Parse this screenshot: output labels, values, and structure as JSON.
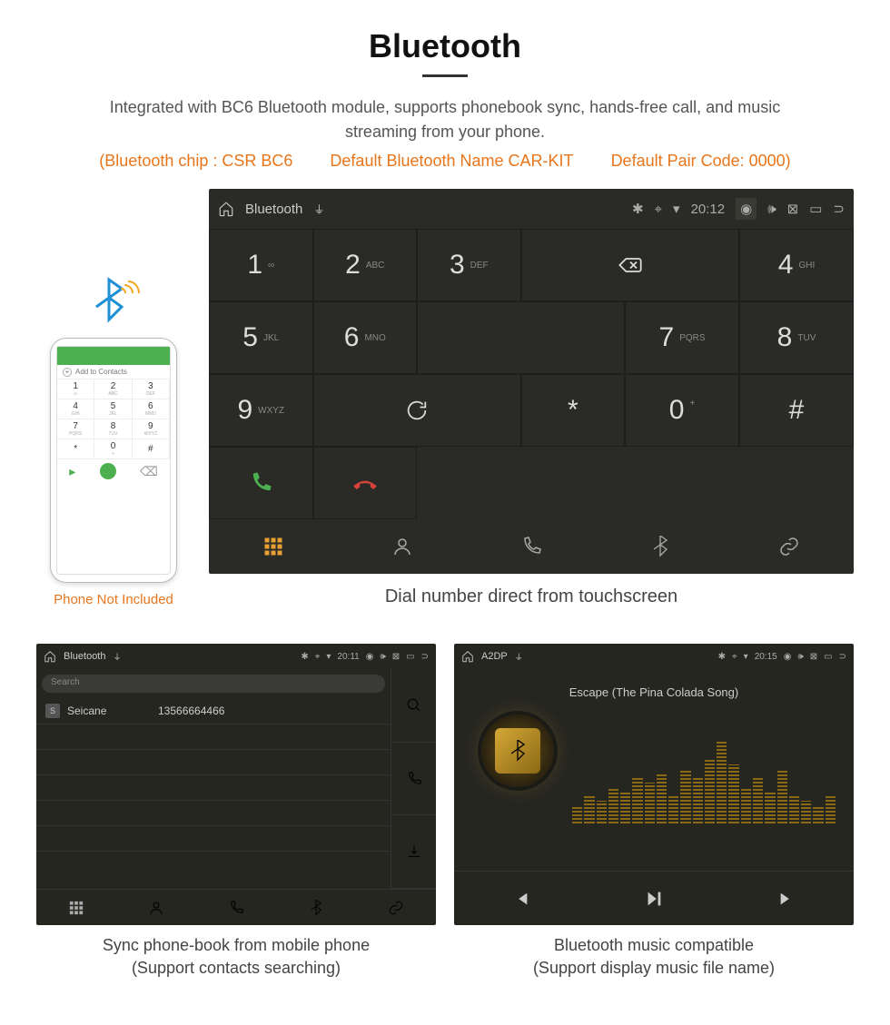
{
  "title": "Bluetooth",
  "description": "Integrated with BC6 Bluetooth module, supports phonebook sync, hands-free call, and music streaming from your phone.",
  "info": {
    "chip": "(Bluetooth chip : CSR BC6",
    "name": "Default Bluetooth Name CAR-KIT",
    "code": "Default Pair Code: 0000)"
  },
  "phone": {
    "add_contacts": "Add to Contacts",
    "caption": "Phone Not Included"
  },
  "dialer": {
    "topbar": {
      "title": "Bluetooth",
      "time": "20:12"
    },
    "keys": [
      {
        "n": "1",
        "s": "∞"
      },
      {
        "n": "2",
        "s": "ABC"
      },
      {
        "n": "3",
        "s": "DEF"
      },
      {
        "n": "4",
        "s": "GHI"
      },
      {
        "n": "5",
        "s": "JKL"
      },
      {
        "n": "6",
        "s": "MNO"
      },
      {
        "n": "7",
        "s": "PQRS"
      },
      {
        "n": "8",
        "s": "TUV"
      },
      {
        "n": "9",
        "s": "WXYZ"
      },
      {
        "n": "*",
        "s": ""
      },
      {
        "n": "0",
        "s": "+"
      },
      {
        "n": "#",
        "s": ""
      }
    ],
    "caption": "Dial number direct from touchscreen"
  },
  "phonebook": {
    "topbar": {
      "title": "Bluetooth",
      "time": "20:11"
    },
    "search_placeholder": "Search",
    "contact": {
      "initial": "S",
      "name": "Seicane",
      "number": "13566664466"
    },
    "caption_l1": "Sync phone-book from mobile phone",
    "caption_l2": "(Support contacts searching)"
  },
  "music": {
    "topbar": {
      "title": "A2DP",
      "time": "20:15"
    },
    "song": "Escape (The Pina Colada Song)",
    "caption_l1": "Bluetooth music compatible",
    "caption_l2": "(Support display music file name)"
  }
}
